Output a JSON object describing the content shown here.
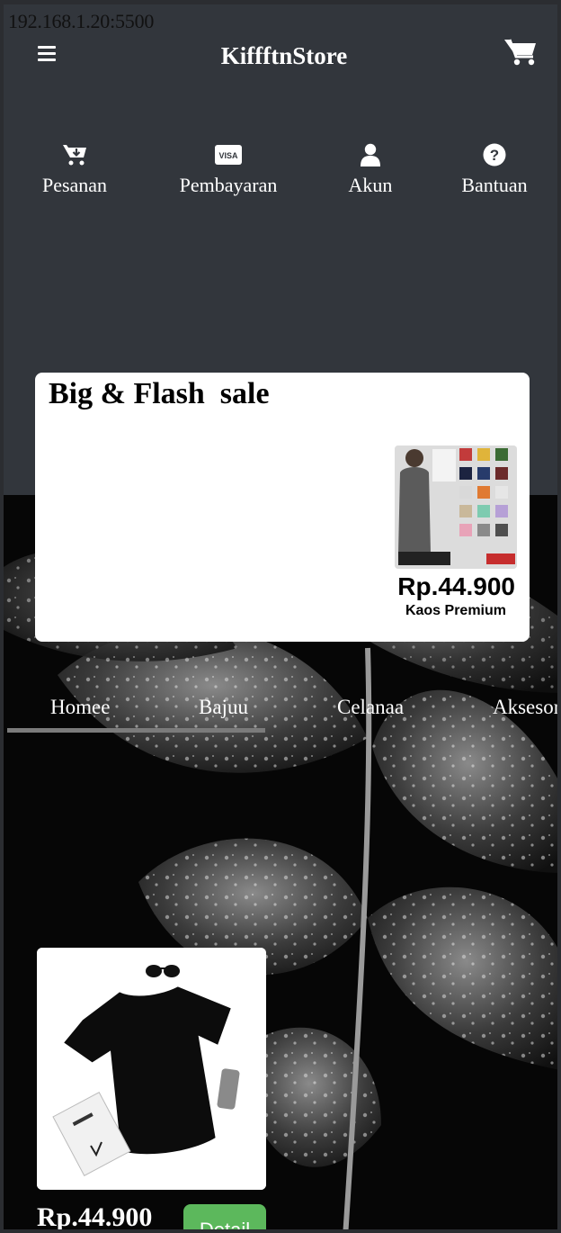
{
  "browser": {
    "url": "192.168.1.20:5500"
  },
  "header": {
    "brand": "KiffftnStore",
    "menu_icon": "hamburger-menu-icon",
    "cart_icon": "shopping-cart-icon"
  },
  "quick_links": [
    {
      "label": "Pesanan",
      "icon": "cart-download-icon"
    },
    {
      "label": "Pembayaran",
      "icon": "visa-card-icon"
    },
    {
      "label": "Akun",
      "icon": "user-icon"
    },
    {
      "label": "Bantuan",
      "icon": "question-circle-icon"
    }
  ],
  "flash_sale": {
    "title": "Big & Flash  sale",
    "product": {
      "price": "Rp.44.900",
      "name": "Kaos Premium",
      "image_icon": "tshirt-product-image"
    }
  },
  "categories": [
    {
      "label": "Homee",
      "active": true
    },
    {
      "label": "Bajuu"
    },
    {
      "label": "Celanaa"
    },
    {
      "label": "Aksesor"
    }
  ],
  "products": [
    {
      "price": "Rp.44.900",
      "button": "Detail",
      "image_icon": "black-tshirt-product-image"
    }
  ],
  "colors": {
    "header_bg": "#32363c",
    "accent_green": "#5cb85c",
    "card_bg": "#ffffff"
  }
}
